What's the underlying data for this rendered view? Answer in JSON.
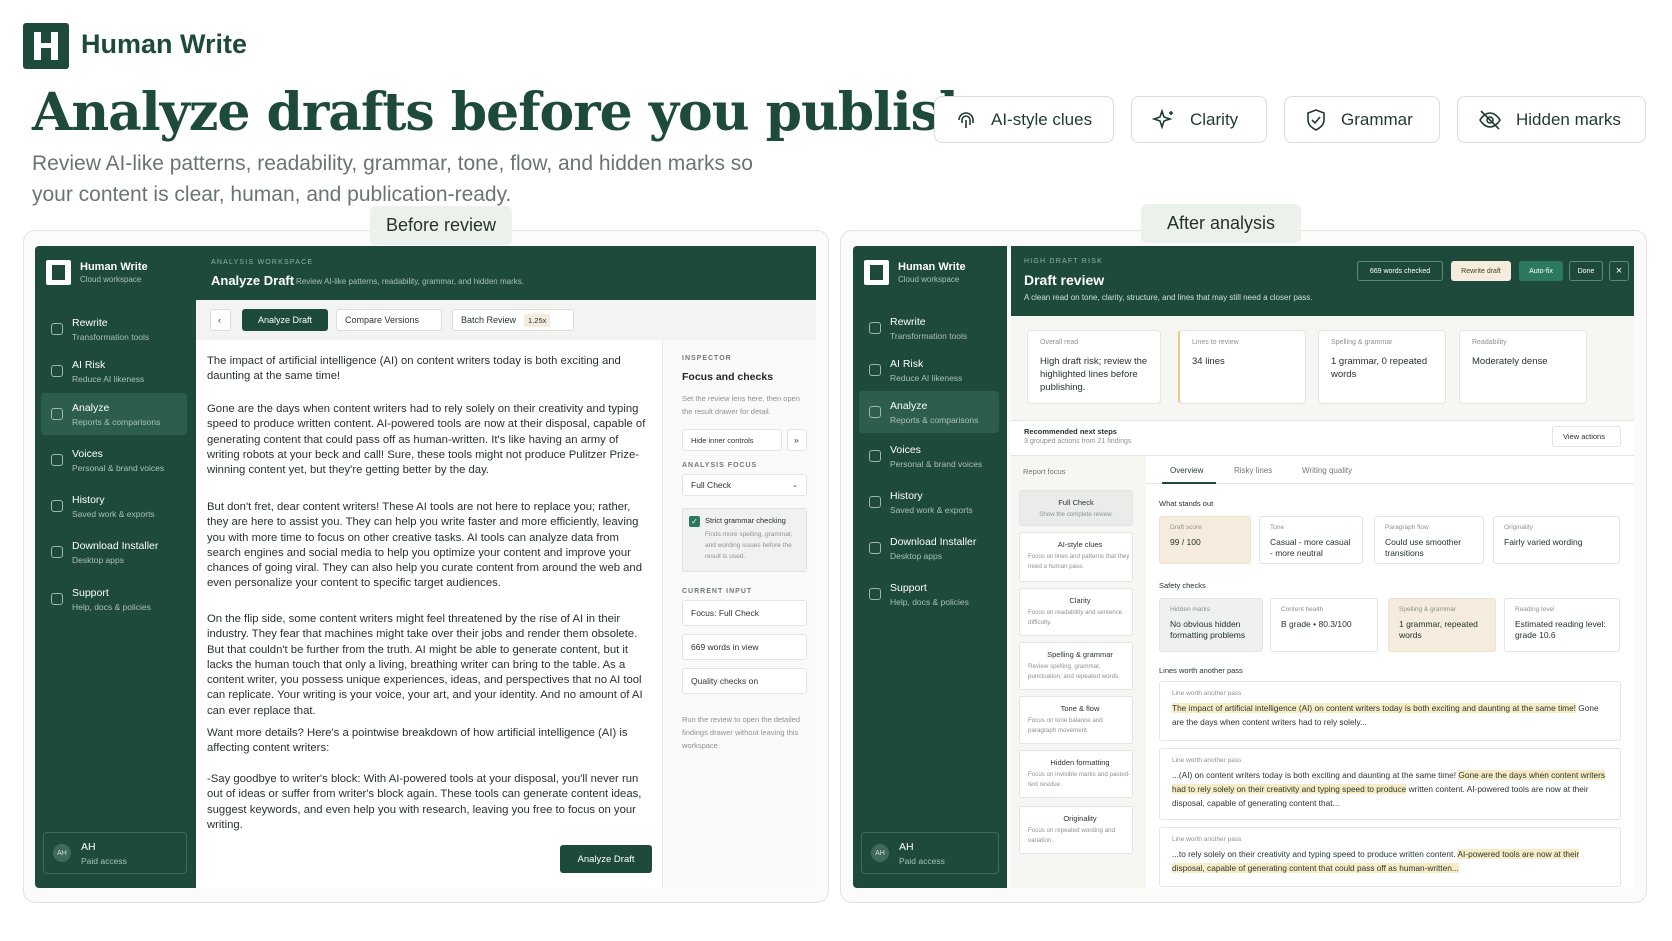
{
  "brand": "Human Write",
  "headline": "Analyze drafts before you publish",
  "subtitle": "Review AI-like patterns, readability, grammar, tone, flow, and hidden marks so your content is clear, human, and publication-ready.",
  "pills": [
    {
      "label": "AI-style clues",
      "icon": "fingerprint-icon"
    },
    {
      "label": "Clarity",
      "icon": "sparkles-icon"
    },
    {
      "label": "Grammar",
      "icon": "shield-check-icon"
    },
    {
      "label": "Hidden marks",
      "icon": "eye-off-icon"
    }
  ],
  "before_tag": "Before review",
  "after_tag": "After analysis",
  "sidebar": {
    "title": "Human Write",
    "subtitle": "Cloud workspace",
    "items": [
      {
        "label": "Rewrite",
        "sub": "Transformation tools"
      },
      {
        "label": "AI Risk",
        "sub": "Reduce AI likeness"
      },
      {
        "label": "Analyze",
        "sub": "Reports & comparisons"
      },
      {
        "label": "Voices",
        "sub": "Personal & brand voices"
      },
      {
        "label": "History",
        "sub": "Saved work & exports"
      },
      {
        "label": "Download Installer",
        "sub": "Desktop apps"
      },
      {
        "label": "Support",
        "sub": "Help, docs & policies"
      }
    ],
    "avatar": "AH",
    "user": "AH",
    "user_sub": "Paid access"
  },
  "left": {
    "eyebrow": "ANALYSIS WORKSPACE",
    "title": "Analyze Draft",
    "title_sub": "Review AI-like patterns, readability, grammar, and hidden marks.",
    "back": "‹",
    "tabs": {
      "analyze": "Analyze Draft",
      "compare": "Compare Versions",
      "batch": "Batch Review",
      "batch_badge": "1.25x"
    },
    "paragraphs": [
      "The impact of artificial intelligence (AI) on content writers today is both exciting and daunting at the same time!",
      "Gone are the days when content writers had to rely solely on their creativity and typing speed to produce written content. AI-powered tools are now at their disposal, capable of generating content that could pass off as human-written. It's like having an army of writing robots at your beck and call! Sure, these tools might not produce Pulitzer Prize-winning content yet, but they're getting better by the day.",
      "But don't fret, dear content writers! These AI tools are not here to replace you; rather, they are here to assist you. They can help you write faster and more efficiently, leaving you with more time to focus on other creative tasks. AI tools can analyze data from search engines and social media to help you optimize your content and improve your chances of going viral. They can also help you curate content from around the web and even personalize your content to specific target audiences.",
      "On the flip side, some content writers might feel threatened by the rise of AI in their industry. They fear that machines might take over their jobs and render them obsolete. But that couldn't be further from the truth. AI might be able to generate content, but it lacks the human touch that only a living, breathing writer can bring to the table. As a content writer, you possess unique experiences, ideas, and perspectives that no AI tool can replicate. Your writing is your voice, your art, and your identity. And no amount of AI can ever replace that.",
      "Want more details? Here's a pointwise breakdown of how artificial intelligence (AI) is affecting content writers:",
      "-Say goodbye to writer's block: With AI-powered tools at your disposal, you'll never run out of ideas or suffer from writer's block again. These tools can generate content ideas, suggest keywords, and even help you with research, leaving you free to focus on your writing."
    ],
    "analyze_button": "Analyze Draft",
    "inspector": {
      "label": "INSPECTOR",
      "title": "Focus and checks",
      "desc": "Set the review lens here, then open the result drawer for detail.",
      "hide": "Hide inner controls",
      "expand": "»",
      "focus_label": "ANALYSIS FOCUS",
      "focus_value": "Full Check",
      "strict_title": "Strict grammar checking",
      "strict_desc": "Finds more spelling, grammar, and wording issues before the result is used.",
      "current_label": "CURRENT INPUT",
      "current": [
        "Focus: Full Check",
        "669 words in view",
        "Quality checks on"
      ],
      "foot": "Run the review to open the detailed findings drawer without leaving this workspace."
    }
  },
  "right": {
    "eyebrow": "HIGH DRAFT RISK",
    "title": "Draft review",
    "desc": "A clean read on tone, clarity, structure, and lines that may still need a closer pass.",
    "words": "669 words checked",
    "rewrite": "Rewrite draft",
    "autofix": "Auto-fix",
    "done": "Done",
    "close": "×",
    "summary": [
      {
        "l": "Overall read",
        "v": "High draft risk; review the highlighted lines before publishing."
      },
      {
        "l": "Lines to review",
        "v": "34 lines"
      },
      {
        "l": "Spelling & grammar",
        "v": "1 grammar, 0 repeated words"
      },
      {
        "l": "Readability",
        "v": "Moderately dense"
      }
    ],
    "next_title": "Recommended next steps",
    "next_sub": "3 grouped actions from 21 findings",
    "view_actions": "View actions",
    "focus_title": "Report focus",
    "focus": [
      {
        "t": "Full Check",
        "d": "Show the complete review."
      },
      {
        "t": "AI-style clues",
        "d": "Focus on lines and patterns that they need a human pass."
      },
      {
        "t": "Clarity",
        "d": "Focus on readability and sentence difficulty."
      },
      {
        "t": "Spelling & grammar",
        "d": "Review spelling, grammar, punctuation, and repeated words."
      },
      {
        "t": "Tone & flow",
        "d": "Focus on tone balance and paragraph movement."
      },
      {
        "t": "Hidden formatting",
        "d": "Focus on invisible marks and pasted-text residue."
      },
      {
        "t": "Originality",
        "d": "Focus on repeated wording and variation."
      }
    ],
    "tabs": [
      "Overview",
      "Risky lines",
      "Writing quality"
    ],
    "stands_title": "What stands out",
    "stands": [
      {
        "l": "Draft score",
        "v": "99 / 100"
      },
      {
        "l": "Tone",
        "v": "Casual - more casual - more neutral"
      },
      {
        "l": "Paragraph flow",
        "v": "Could use smoother transitions"
      },
      {
        "l": "Originality",
        "v": "Fairly varied wording"
      }
    ],
    "safety_title": "Safety checks",
    "safety": [
      {
        "l": "Hidden marks",
        "v": "No obvious hidden formatting problems"
      },
      {
        "l": "Content health",
        "v": "B grade • 80.3/100"
      },
      {
        "l": "Spelling & grammar",
        "v": "1 grammar, repeated words"
      },
      {
        "l": "Reading level",
        "v": "Estimated reading level: grade 10.6"
      }
    ],
    "lines_title": "Lines worth another pass",
    "lines": [
      {
        "l": "Line worth another pass",
        "h": "The impact of artificial intelligence (AI) on content writers today is both exciting and daunting at the same time!",
        "t": " Gone are the days when content writers had to rely solely..."
      },
      {
        "l": "Line worth another pass",
        "p": "...(AI) on content writers today is both exciting and daunting at the same time! ",
        "h": "Gone are the days when content writers had to rely solely on their creativity and typing speed to produce",
        "t": " written content. AI-powered tools are now at their disposal, capable of generating content that..."
      },
      {
        "l": "Line worth another pass",
        "p": "...to rely solely on their creativity and typing speed to produce written content. ",
        "h": "AI-powered tools are now at their disposal, capable of generating content that could pass off as human-written...",
        "t": ""
      }
    ]
  },
  "colors": {
    "brand": "#1d4a3a",
    "highlight": "#f7ecc6",
    "accent_card": "#f5ecdd"
  }
}
